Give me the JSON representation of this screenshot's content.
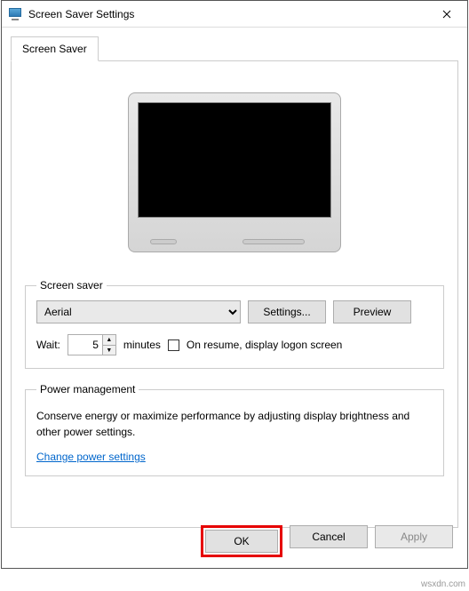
{
  "window": {
    "title": "Screen Saver Settings",
    "close_tooltip": "Close"
  },
  "tabs": {
    "screensaver_label": "Screen Saver"
  },
  "screensaver_group": {
    "legend": "Screen saver",
    "selected": "Aerial",
    "settings_btn": "Settings...",
    "preview_btn": "Preview",
    "wait_label": "Wait:",
    "wait_value": "5",
    "minutes_label": "minutes",
    "resume_label": "On resume, display logon screen"
  },
  "power_group": {
    "legend": "Power management",
    "description": "Conserve energy or maximize performance by adjusting display brightness and other power settings.",
    "link": "Change power settings"
  },
  "buttons": {
    "ok": "OK",
    "cancel": "Cancel",
    "apply": "Apply"
  },
  "watermark": "wsxdn.com"
}
